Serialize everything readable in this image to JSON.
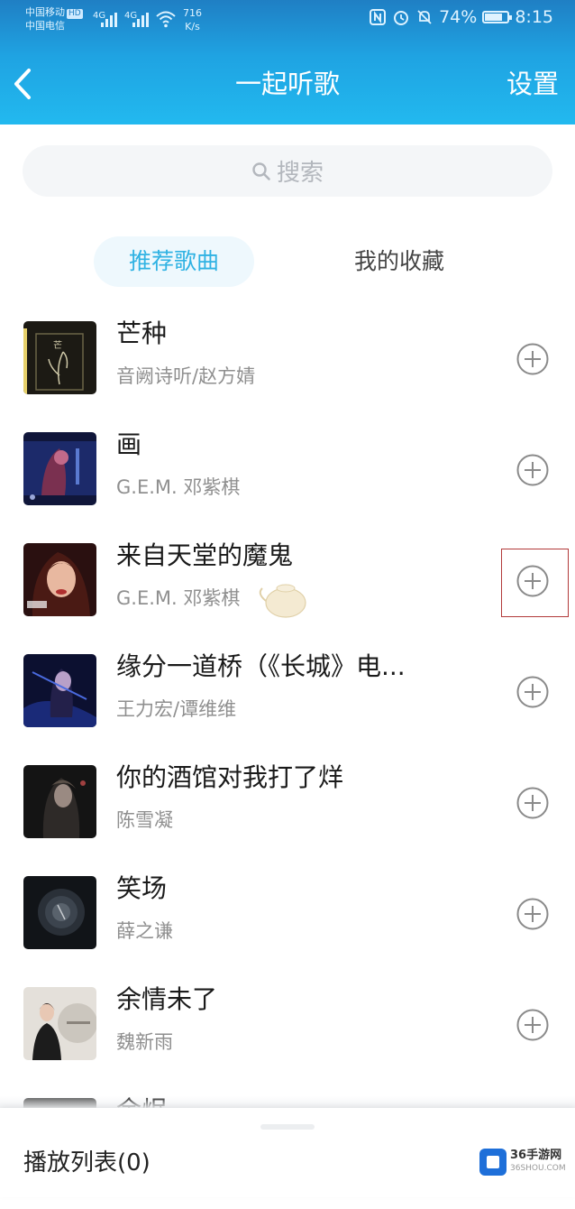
{
  "status_bar": {
    "carrier1": "中国移动",
    "carrier1_badge": "HD",
    "carrier2": "中国电信",
    "net1": "4G",
    "net2": "4G",
    "speed_value": "716",
    "speed_unit": "K/s",
    "battery": "74%",
    "time": "8:15"
  },
  "navbar": {
    "title": "一起听歌",
    "settings_label": "设置"
  },
  "search": {
    "placeholder": "搜索"
  },
  "tabs": {
    "recommended": "推荐歌曲",
    "favorites": "我的收藏",
    "active": "recommended"
  },
  "songs": [
    {
      "title": "芒种",
      "artist": "音阙诗听/赵方婧"
    },
    {
      "title": "画",
      "artist": "G.E.M. 邓紫棋"
    },
    {
      "title": "来自天堂的魔鬼",
      "artist": "G.E.M. 邓紫棋"
    },
    {
      "title": "缘分一道桥（《长城》电...",
      "artist": "王力宏/谭维维"
    },
    {
      "title": "你的酒馆对我打了烊",
      "artist": "陈雪凝"
    },
    {
      "title": "笑场",
      "artist": "薛之谦"
    },
    {
      "title": "余情未了",
      "artist": "魏新雨"
    },
    {
      "title": "余烬",
      "artist": ""
    }
  ],
  "bottom_bar": {
    "playlist_label": "播放列表(0)"
  },
  "watermark": {
    "name": "36手游网",
    "url": "36SHOU.COM"
  },
  "colors": {
    "header_start": "#1f7fc4",
    "header_end": "#22b9ef",
    "accent": "#2fb2e3",
    "highlight_box": "#b23a3a"
  }
}
